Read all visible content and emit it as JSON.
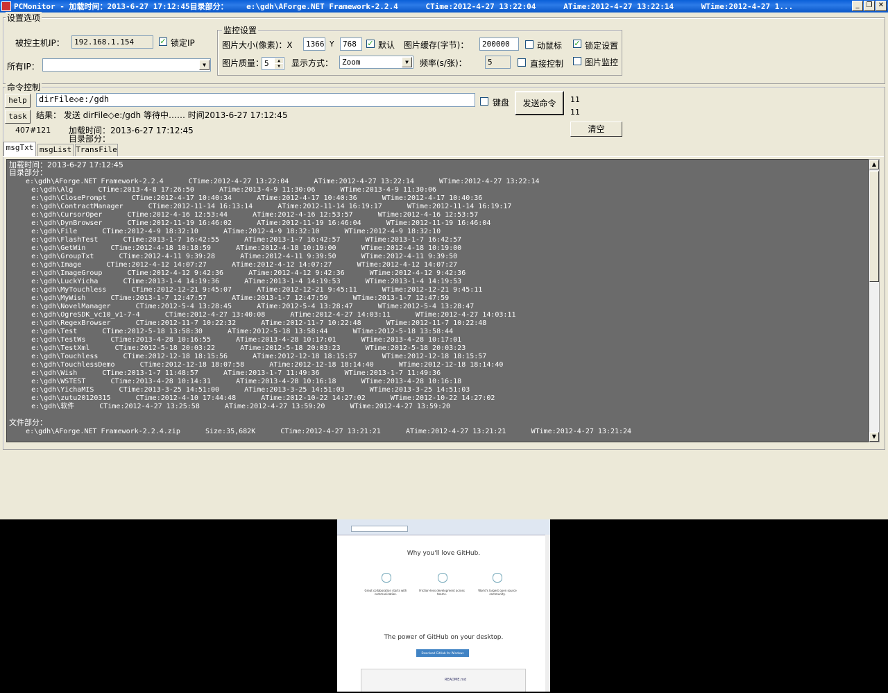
{
  "window": {
    "title": "PCMonitor - 加载时间：2013-6-27 17:12:45目录部分：    e:\\gdh\\AForge.NET Framework-2.2.4      CTime:2012-4-27 13:22:04      ATime:2012-4-27 13:22:14      WTime:2012-4-27 1...",
    "min": "_",
    "max": "❐",
    "close": "✕"
  },
  "settings": {
    "group_label": "设置选项",
    "host_ip_label": "被控主机IP：",
    "host_ip_value": "192.168.1.154",
    "lock_ip_label": "锁定IP",
    "lock_ip_checked": "✓",
    "all_ip_label": "所有IP：",
    "all_ip_value": ""
  },
  "monitor": {
    "group_label": "监控设置",
    "img_size_label": "图片大小(像素)：X",
    "width_value": "1366",
    "y_label": "Y",
    "height_value": "768",
    "default_label": "默认",
    "default_checked": "✓",
    "cache_label": "图片缓存(字节)：",
    "cache_value": "200000",
    "move_mouse_label": "动鼠标",
    "lock_settings_label": "锁定设置",
    "lock_settings_checked": "✓",
    "quality_label": "图片质量：",
    "quality_value": "5",
    "display_label": "显示方式：",
    "display_value": "Zoom",
    "freq_label": "频率(s/张)：",
    "freq_value": "5",
    "direct_label": "直接控制",
    "img_monitor_label": "图片监控"
  },
  "command": {
    "group_label": "命令控制",
    "help_label": "help",
    "task_label": "task",
    "input_value": "dirFile◇e:/gdh",
    "keyboard_label": "键盘",
    "send_label": "发送命令",
    "count1": "11",
    "count2": "11",
    "result_text": "结果：  发送 dirFile◇e:/gdh 等待中……  时间2013-6-27 17:12:45",
    "id_text": "407#121",
    "load_time_text": "加载时间：2013-6-27 17:12:45",
    "dir_text": "目录部分：",
    "clear_label": "清空"
  },
  "tabs": [
    "msgTxt",
    "msgList",
    "TransFile"
  ],
  "log": {
    "header1": "加载时间：2013-6-27 17:12:45",
    "header2": "目录部分：",
    "lines": [
      "e:\\gdh\\AForge.NET Framework-2.2.4      CTime:2012-4-27 13:22:04      ATime:2012-4-27 13:22:14      WTime:2012-4-27 13:22:14",
      "    e:\\gdh\\Alg      CTime:2013-4-8 17:26:50      ATime:2013-4-9 11:30:06      WTime:2013-4-9 11:30:06",
      "    e:\\gdh\\ClosePrompt      CTime:2012-4-17 10:40:34      ATime:2012-4-17 10:40:36      WTime:2012-4-17 10:40:36",
      "    e:\\gdh\\ContractManager      CTime:2012-11-14 16:13:14      ATime:2012-11-14 16:19:17      WTime:2012-11-14 16:19:17",
      "    e:\\gdh\\CursorOper      CTime:2012-4-16 12:53:44      ATime:2012-4-16 12:53:57      WTime:2012-4-16 12:53:57",
      "    e:\\gdh\\DynBrowser      CTime:2012-11-19 16:46:02      ATime:2012-11-19 16:46:04      WTime:2012-11-19 16:46:04",
      "    e:\\gdh\\File      CTime:2012-4-9 18:32:10      ATime:2012-4-9 18:32:10      WTime:2012-4-9 18:32:10",
      "    e:\\gdh\\FlashTest      CTime:2013-1-7 16:42:55      ATime:2013-1-7 16:42:57      WTime:2013-1-7 16:42:57",
      "    e:\\gdh\\GetWin      CTime:2012-4-18 10:18:59      ATime:2012-4-18 10:19:00      WTime:2012-4-18 10:19:00",
      "    e:\\gdh\\GroupTxt      CTime:2012-4-11 9:39:28      ATime:2012-4-11 9:39:50      WTime:2012-4-11 9:39:50",
      "    e:\\gdh\\Image      CTime:2012-4-12 14:07:27      ATime:2012-4-12 14:07:27      WTime:2012-4-12 14:07:27",
      "    e:\\gdh\\ImageGroup      CTime:2012-4-12 9:42:36      ATime:2012-4-12 9:42:36      WTime:2012-4-12 9:42:36",
      "    e:\\gdh\\LuckYicha      CTime:2013-1-4 14:19:36      ATime:2013-1-4 14:19:53      WTime:2013-1-4 14:19:53",
      "    e:\\gdh\\MyTouchless      CTime:2012-12-21 9:45:07      ATime:2012-12-21 9:45:11      WTime:2012-12-21 9:45:11",
      "    e:\\gdh\\MyWish      CTime:2013-1-7 12:47:57      ATime:2013-1-7 12:47:59      WTime:2013-1-7 12:47:59",
      "    e:\\gdh\\NovelManager      CTime:2012-5-4 13:28:45      ATime:2012-5-4 13:28:47      WTime:2012-5-4 13:28:47",
      "    e:\\gdh\\OgreSDK_vc10_v1-7-4      CTime:2012-4-27 13:40:08      ATime:2012-4-27 14:03:11      WTime:2012-4-27 14:03:11",
      "    e:\\gdh\\RegexBrowser      CTime:2012-11-7 10:22:32      ATime:2012-11-7 10:22:48      WTime:2012-11-7 10:22:48",
      "    e:\\gdh\\Test      CTime:2012-5-18 13:58:30      ATime:2012-5-18 13:58:44      WTime:2012-5-18 13:58:44",
      "    e:\\gdh\\TestWs      CTime:2013-4-28 10:16:55      ATime:2013-4-28 10:17:01      WTime:2013-4-28 10:17:01",
      "    e:\\gdh\\TestXml      CTime:2012-5-18 20:03:22      ATime:2012-5-18 20:03:23      WTime:2012-5-18 20:03:23",
      "    e:\\gdh\\Touchless      CTime:2012-12-18 18:15:56      ATime:2012-12-18 18:15:57      WTime:2012-12-18 18:15:57",
      "    e:\\gdh\\TouchlessDemo      CTime:2012-12-18 18:07:58      ATime:2012-12-18 18:14:40      WTime:2012-12-18 18:14:40",
      "    e:\\gdh\\Wish      CTime:2013-1-7 11:48:57      ATime:2013-1-7 11:49:36      WTime:2013-1-7 11:49:36",
      "    e:\\gdh\\WSTEST      CTime:2013-4-28 10:14:31      ATime:2013-4-28 10:16:18      WTime:2013-4-28 10:16:18",
      "    e:\\gdh\\YichaMIS      CTime:2013-3-25 14:51:00      ATime:2013-3-25 14:51:03      WTime:2013-3-25 14:51:03",
      "    e:\\gdh\\zutu20120315      CTime:2012-4-10 17:44:48      ATime:2012-10-22 14:27:02      WTime:2012-10-22 14:27:02",
      "    e:\\gdh\\软件      CTime:2012-4-27 13:25:58      ATime:2012-4-27 13:59:20      WTime:2012-4-27 13:59:20"
    ],
    "files_header": "文件部分：",
    "file_line": "    e:\\gdh\\AForge.NET Framework-2.2.4.zip      Size:35,682K      CTime:2012-4-27 13:21:21      ATime:2012-4-27 13:21:21      WTime:2012-4-27 13:21:24"
  },
  "remote": {
    "heading1": "Why you'll love GitHub.",
    "heading2": "The power of GitHub on your desktop.",
    "feature1": "Great collaboration starts with communication.",
    "feature2": "Friction-less development across teams.",
    "feature3": "World's largest open source community.",
    "download_label": "Download GitHub for Windows",
    "readme": "README.md"
  }
}
